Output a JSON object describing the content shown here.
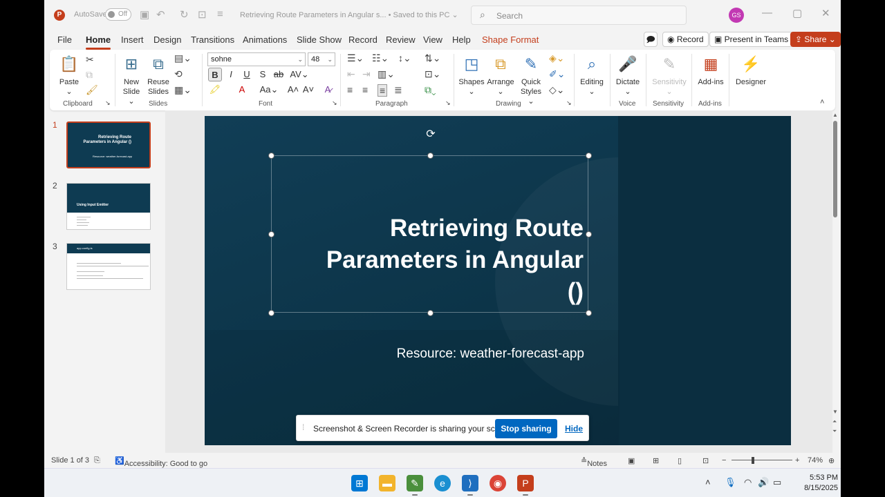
{
  "titlebar": {
    "autosave_label": "AutoSave",
    "autosave_state": "Off",
    "document_title": "Retrieving Route Parameters in Angular s...",
    "save_status": "• Saved to this PC",
    "search_placeholder": "Search",
    "user_initials": "GS"
  },
  "menu": {
    "tabs": [
      "File",
      "Home",
      "Insert",
      "Design",
      "Transitions",
      "Animations",
      "Slide Show",
      "Record",
      "Review",
      "View",
      "Help",
      "Shape Format"
    ],
    "active_tab": "Home",
    "record_label": "Record",
    "teams_label": "Present in Teams",
    "share_label": "Share"
  },
  "ribbon": {
    "clipboard": {
      "paste": "Paste",
      "group": "Clipboard"
    },
    "slides": {
      "new_slide_1": "New",
      "new_slide_2": "Slide",
      "reuse_1": "Reuse",
      "reuse_2": "Slides",
      "group": "Slides"
    },
    "font": {
      "family": "sohne",
      "size": "48",
      "group": "Font"
    },
    "paragraph": {
      "group": "Paragraph"
    },
    "drawing": {
      "shapes": "Shapes",
      "arrange": "Arrange",
      "quick_1": "Quick",
      "quick_2": "Styles",
      "group": "Drawing"
    },
    "editing": {
      "label": "Editing"
    },
    "voice": {
      "dictate": "Dictate",
      "group": "Voice"
    },
    "sensitivity": {
      "label": "Sensitivity",
      "group": "Sensitivity"
    },
    "addins": {
      "label": "Add-ins",
      "group": "Add-ins"
    },
    "designer": {
      "label": "Designer"
    }
  },
  "thumbnails": [
    {
      "number": "1",
      "title": "Retrieving Route Parameters in Angular ()",
      "subtitle": "Resource: weather-forecast-app"
    },
    {
      "number": "2",
      "title": "Using Input Emitter"
    },
    {
      "number": "3",
      "title": "app.config.ts"
    }
  ],
  "slide": {
    "title_line1": "Retrieving Route",
    "title_line2": "Parameters in Angular",
    "title_line3": "()",
    "subtitle": "Resource: weather-forecast-app"
  },
  "share_banner": {
    "message": "Screenshot & Screen Recorder is sharing your screen.",
    "stop_label": "Stop sharing",
    "hide_label": "Hide"
  },
  "statusbar": {
    "slide_position": "Slide 1 of 3",
    "accessibility": "Accessibility: Good to go",
    "notes_label": "Notes",
    "zoom": "74%"
  },
  "taskbar": {
    "time": "5:53 PM",
    "date": "8/15/2025"
  },
  "colors": {
    "accent": "#c43e1c",
    "slide_bg": "#0e3b52",
    "share_button": "#0067c0"
  }
}
